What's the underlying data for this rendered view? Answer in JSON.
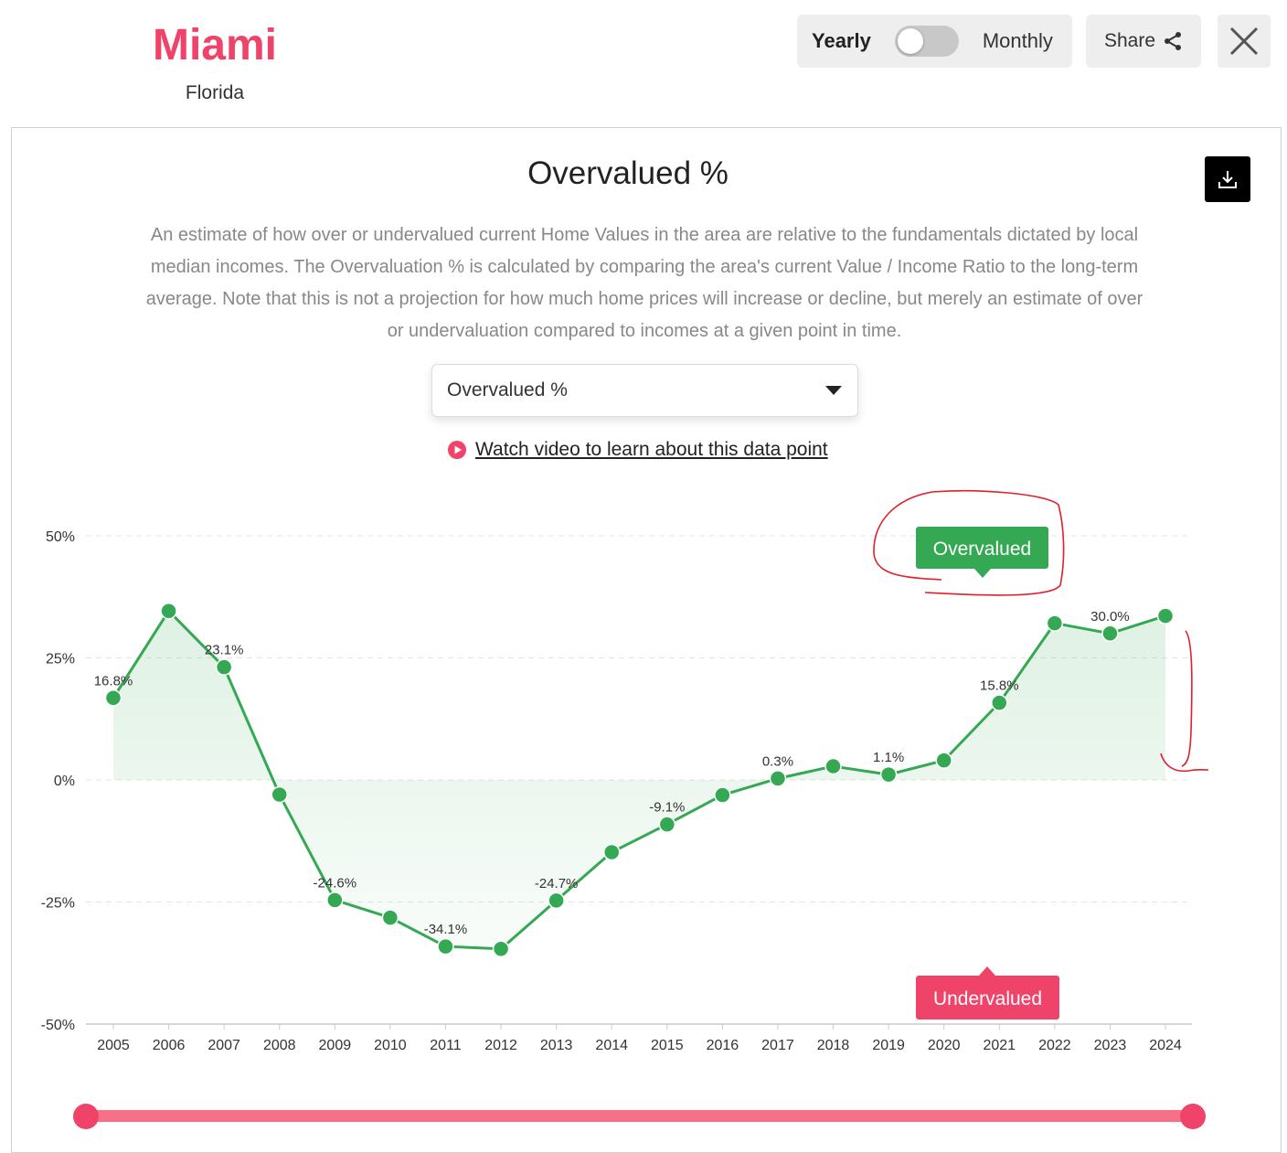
{
  "header": {
    "city": "Miami",
    "state": "Florida",
    "toggle_left": "Yearly",
    "toggle_right": "Monthly",
    "share_label": "Share"
  },
  "icons": {
    "share": "share-icon",
    "close": "close-icon",
    "download": "download-icon",
    "play": "play-icon",
    "dropdown": "caret-down-icon"
  },
  "colors": {
    "brand": "#f0436a",
    "line": "#34a853",
    "overvalued": "#34a853",
    "undervalued": "#f0436a"
  },
  "main": {
    "description": "An estimate of how over or undervalued current Home Values in the area are relative to the fundamentals dictated by local median incomes. The Overvaluation % is calculated by comparing the area's current Value / Income Ratio to the long-term average. Note that this is not a projection for how much home prices will increase or decline, but merely an estimate of over or undervaluation compared to incomes at a given point in time.",
    "select_value": "Overvalued %",
    "video_link": "Watch video to learn about this data point"
  },
  "chart_data": {
    "type": "line",
    "title": "Overvalued %",
    "x": [
      "2005",
      "2006",
      "2007",
      "2008",
      "2009",
      "2010",
      "2011",
      "2012",
      "2013",
      "2014",
      "2015",
      "2016",
      "2017",
      "2018",
      "2019",
      "2020",
      "2021",
      "2022",
      "2023",
      "2024"
    ],
    "series": [
      {
        "values": [
          16.8,
          34.6,
          23.1,
          -3.0,
          -24.6,
          -28.2,
          -34.1,
          -34.6,
          -24.7,
          -14.8,
          -9.1,
          -3.1,
          0.3,
          2.8,
          1.1,
          4.0,
          15.8,
          32.1,
          30.0,
          33.6
        ]
      }
    ],
    "data_labels": [
      {
        "index": 0,
        "text": "16.8%"
      },
      {
        "index": 2,
        "text": "23.1%"
      },
      {
        "index": 4,
        "text": "-24.6%"
      },
      {
        "index": 6,
        "text": "-34.1%"
      },
      {
        "index": 8,
        "text": "-24.7%"
      },
      {
        "index": 10,
        "text": "-9.1%"
      },
      {
        "index": 12,
        "text": "0.3%"
      },
      {
        "index": 14,
        "text": "1.1%"
      },
      {
        "index": 16,
        "text": "15.8%"
      },
      {
        "index": 18,
        "text": "30.0%"
      }
    ],
    "yticks": [
      50,
      25,
      0,
      -25,
      -50
    ],
    "ytick_labels": [
      "50%",
      "25%",
      "0%",
      "-25%",
      "-50%"
    ],
    "ylim": [
      -50,
      50
    ],
    "grid": true,
    "fill": "area-to-zero",
    "badges": {
      "overvalued": "Overvalued",
      "undervalued": "Undervalued"
    }
  }
}
